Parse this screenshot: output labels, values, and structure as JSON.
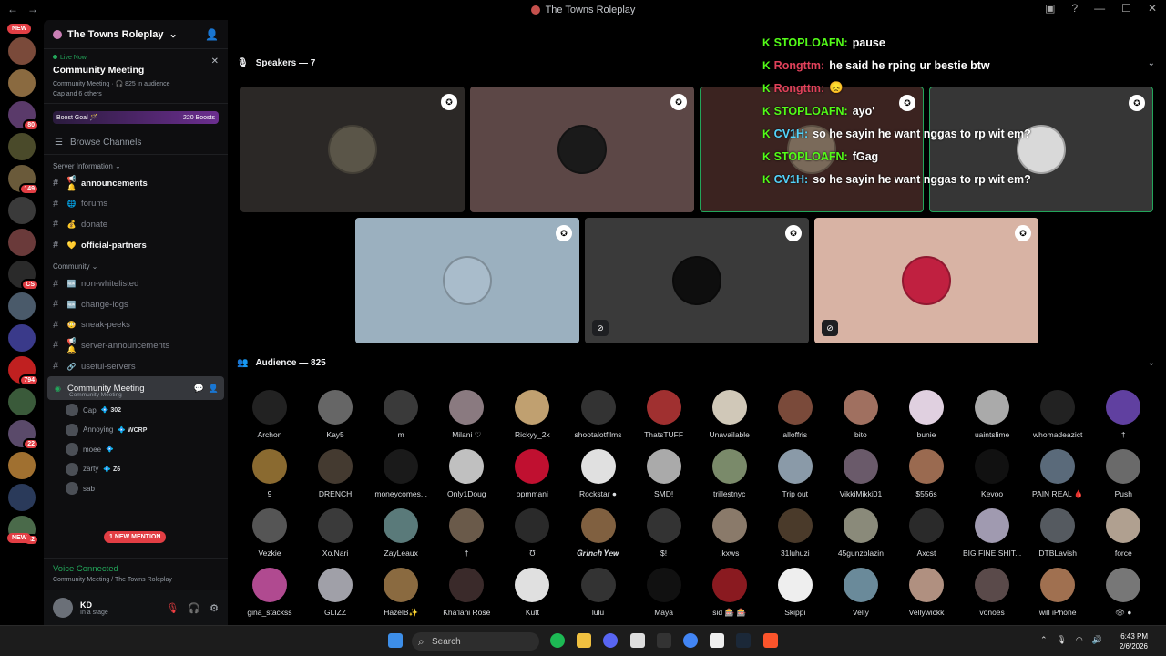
{
  "window": {
    "title": "The Towns Roleplay"
  },
  "rail": {
    "new_top": "NEW",
    "new_bottom": "NEW",
    "cs_label": "Cs",
    "servers": [
      {
        "color": "#7a4a3a",
        "badge": ""
      },
      {
        "color": "#8a6a40",
        "badge": ""
      },
      {
        "color": "#5a3a6a",
        "badge": "80"
      },
      {
        "color": "#4a4a2a",
        "badge": ""
      },
      {
        "color": "#6a5a3a",
        "badge": "149"
      },
      {
        "color": "#3a3a3a",
        "badge": ""
      },
      {
        "color": "#6a3a3a",
        "badge": ""
      },
      {
        "color": "#2a2a2a",
        "badge": "CS"
      },
      {
        "color": "#4a5a6a",
        "badge": ""
      },
      {
        "color": "#3a3a8a",
        "badge": ""
      },
      {
        "color": "#c02020",
        "badge": "794"
      },
      {
        "color": "#3a5a3a",
        "badge": ""
      },
      {
        "color": "#5a4a6a",
        "badge": "22"
      },
      {
        "color": "#a07030",
        "badge": ""
      },
      {
        "color": "#2a3a5a",
        "badge": ""
      },
      {
        "color": "#4a6a4a",
        "badge": "52"
      }
    ]
  },
  "sidebar": {
    "guild_name": "The Towns Roleplay",
    "live": {
      "tag": "Live Now",
      "title": "Community Meeting",
      "stats": "Community Meeting · 🎧 825 in audience",
      "participants": "Cap and 6 others"
    },
    "boost": {
      "label": "Boost Goal 🪄",
      "count": "220 Boosts"
    },
    "browse_label": "Browse Channels",
    "server_info_label": "Server Information",
    "server_channels": [
      {
        "icon": "📢🔔",
        "name": "announcements",
        "bright": true
      },
      {
        "icon": "🌐",
        "name": "forums",
        "bright": false
      },
      {
        "icon": "💰",
        "name": "donate",
        "bright": false
      },
      {
        "icon": "💛",
        "name": "official-partners",
        "bright": true
      }
    ],
    "community_label": "Community",
    "community_channels": [
      {
        "icon": "🆕",
        "name": "non-whitelisted"
      },
      {
        "icon": "🆕",
        "name": "change-logs"
      },
      {
        "icon": "😳",
        "name": "sneak-peeks"
      },
      {
        "icon": "📢🔔",
        "name": "server-announcements"
      },
      {
        "icon": "🔗",
        "name": "useful-servers"
      }
    ],
    "active_stage": {
      "name": "Community Meeting",
      "sub": "Community Meeting"
    },
    "stage_members": [
      {
        "name": "Cap",
        "tag": "💠 302"
      },
      {
        "name": "Annoying",
        "tag": "💠 WCRP"
      },
      {
        "name": "moee",
        "tag": "💠"
      },
      {
        "name": "zarty",
        "tag": "💠 Z6"
      },
      {
        "name": "sab",
        "tag": ""
      }
    ],
    "new_mention": "1 NEW MENTION",
    "voice": {
      "status": "Voice Connected",
      "location": "Community Meeting / The Towns Roleplay"
    },
    "user": {
      "name": "KD",
      "status": "In a stage"
    }
  },
  "main": {
    "speakers_label": "Speakers — 7",
    "audience_label": "Audience — 825",
    "speakers": [
      {
        "bg": "#2b2826",
        "avatar": "#5a5548",
        "speaking": false,
        "muted": false
      },
      {
        "bg": "#5c4746",
        "avatar": "#1a1a1a",
        "speaking": false,
        "muted": false
      },
      {
        "bg": "#3b2320",
        "avatar": "#7a6a5a",
        "speaking": true,
        "muted": false
      },
      {
        "bg": "#363636",
        "avatar": "#d9d9d9",
        "speaking": true,
        "muted": false
      },
      {
        "bg": "#9bb0bf",
        "avatar": "#a9bccb",
        "speaking": false,
        "muted": false
      },
      {
        "bg": "#3a3a3a",
        "avatar": "#0e0e0e",
        "speaking": false,
        "muted": true
      },
      {
        "bg": "#d8b3a4",
        "avatar": "#c02040",
        "speaking": false,
        "muted": true
      }
    ],
    "chat": [
      {
        "user": "STOPLOAFN:",
        "text": "pause",
        "color": "#53fc18"
      },
      {
        "user": "Rongttm:",
        "text": "he said he rping ur bestie btw",
        "color": "#e0415a"
      },
      {
        "user": "Rongttm:",
        "text": "😞",
        "color": "#e0415a"
      },
      {
        "user": "STOPLOAFN:",
        "text": "ayo'",
        "color": "#53fc18"
      },
      {
        "user": "CV1H:",
        "text": "so he sayin he want nggas to rp wit em?",
        "color": "#53d4fc"
      },
      {
        "user": "STOPLOAFN:",
        "text": "fGag",
        "color": "#53fc18"
      },
      {
        "user": "CV1H:",
        "text": "so he sayin he want nggas to rp wit em?",
        "color": "#53d4fc"
      }
    ],
    "audience": [
      {
        "name": "Archon",
        "color": "#222"
      },
      {
        "name": "Kay5",
        "color": "#666"
      },
      {
        "name": "m",
        "color": "#3a3a3a"
      },
      {
        "name": "Milani ♡",
        "color": "#8a7a80"
      },
      {
        "name": "Rickyy_2x",
        "color": "#c0a070"
      },
      {
        "name": "shootalotfilms",
        "color": "#333"
      },
      {
        "name": "ThatsTUFF",
        "color": "#a03030"
      },
      {
        "name": "Unavailable",
        "color": "#d0c8b8"
      },
      {
        "name": "alloffris",
        "color": "#7a4a3a"
      },
      {
        "name": "bito",
        "color": "#a07060"
      },
      {
        "name": "bunie",
        "color": "#e0d0e0"
      },
      {
        "name": "uaintslime",
        "color": "#aaa"
      },
      {
        "name": "whomadeazict",
        "color": "#222"
      },
      {
        "name": "†",
        "color": "#6040a0"
      },
      {
        "name": "9",
        "color": "#8a6a30"
      },
      {
        "name": "DRENCH",
        "color": "#443a30"
      },
      {
        "name": "moneycomes...",
        "color": "#1a1a1a"
      },
      {
        "name": "Only1Doug",
        "color": "#c0c0c0"
      },
      {
        "name": "opmmani",
        "color": "#c01030"
      },
      {
        "name": "Rockstar ●",
        "color": "#e0e0e0"
      },
      {
        "name": "SMD!",
        "color": "#aaa"
      },
      {
        "name": "trillestnyc",
        "color": "#7a8a6a"
      },
      {
        "name": "Trip out",
        "color": "#8a9aa8"
      },
      {
        "name": "VikkiMikki01",
        "color": "#6a5a6a"
      },
      {
        "name": "$556s",
        "color": "#9a6a50"
      },
      {
        "name": "Kevoo",
        "color": "#111"
      },
      {
        "name": "PAIN REAL 🩸",
        "color": "#5a6a7a"
      },
      {
        "name": "Push",
        "color": "#6a6a6a"
      },
      {
        "name": "Vezkie",
        "color": "#555"
      },
      {
        "name": "Xo.Nari",
        "color": "#3a3a3a"
      },
      {
        "name": "ZayLeaux",
        "color": "#5a7a7a"
      },
      {
        "name": "†",
        "color": "#6a5a4a"
      },
      {
        "name": "Ʊ",
        "color": "#2a2a2a"
      },
      {
        "name": "𝑮𝒓𝒊𝒏𝒄𝒉 𝒀𝒆𝒘",
        "color": "#806040"
      },
      {
        "name": "$!",
        "color": "#333"
      },
      {
        "name": ".kxws",
        "color": "#8a7a6a"
      },
      {
        "name": "31luhuzi",
        "color": "#4a3a2a"
      },
      {
        "name": "45gunzblazin",
        "color": "#8a8a7a"
      },
      {
        "name": "Axcst",
        "color": "#2a2a2a"
      },
      {
        "name": "BIG FINE SHIT...",
        "color": "#a09ab0"
      },
      {
        "name": "DTBLavish",
        "color": "#555a60"
      },
      {
        "name": "force",
        "color": "#b0a090"
      },
      {
        "name": "gina_stackss",
        "color": "#b04a90"
      },
      {
        "name": "GLIZZ",
        "color": "#a0a0a8"
      },
      {
        "name": "HazelB✨",
        "color": "#8a6a40"
      },
      {
        "name": "Kha'lani Rose",
        "color": "#3a2a2a"
      },
      {
        "name": "Kutt",
        "color": "#e0e0e0"
      },
      {
        "name": "lulu",
        "color": "#333"
      },
      {
        "name": "Maya",
        "color": "#111"
      },
      {
        "name": "sid 🎰 🎰",
        "color": "#8a1a20"
      },
      {
        "name": "Skippi",
        "color": "#eee"
      },
      {
        "name": "Velly",
        "color": "#6a8a9a"
      },
      {
        "name": "Vellywickk",
        "color": "#b09080"
      },
      {
        "name": "vonoes",
        "color": "#5a4a4a"
      },
      {
        "name": "will iPhone",
        "color": "#a07050"
      },
      {
        "name": "👁 ●",
        "color": "#777"
      }
    ]
  },
  "taskbar": {
    "search_placeholder": "Search",
    "time": "6:43 PM",
    "date": "2/6/2026",
    "icons": [
      {
        "name": "spotify-icon",
        "color": "#1db954"
      },
      {
        "name": "folder-icon",
        "color": "#f0c040"
      },
      {
        "name": "discord-icon",
        "color": "#5865f2"
      },
      {
        "name": "app-icon",
        "color": "#ddd"
      },
      {
        "name": "epic-icon",
        "color": "#333"
      },
      {
        "name": "chrome-icon",
        "color": "#4285f4"
      },
      {
        "name": "gog-icon",
        "color": "#eee"
      },
      {
        "name": "steam-icon",
        "color": "#1b2838"
      },
      {
        "name": "brave-icon",
        "color": "#fb542b"
      }
    ]
  }
}
